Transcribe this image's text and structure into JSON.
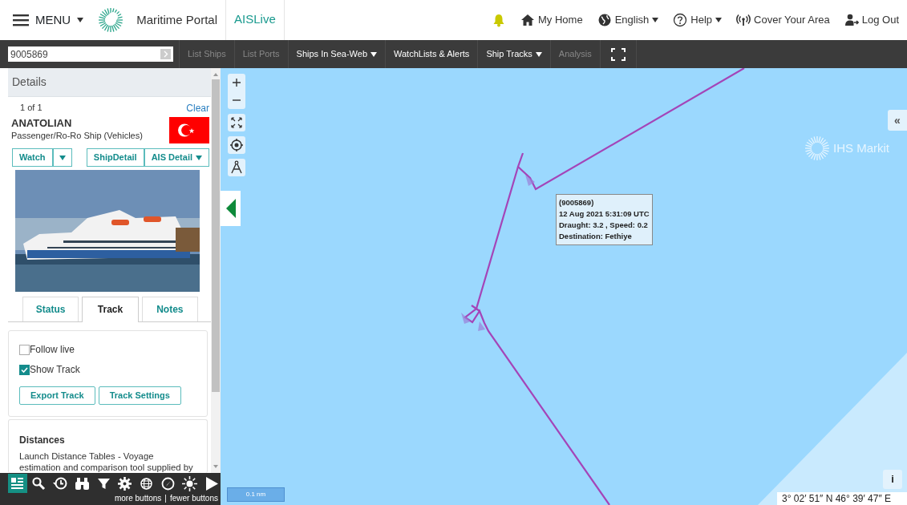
{
  "header": {
    "menu_label": "MENU",
    "portal_title": "Maritime Portal",
    "app_name": "AISLive",
    "links": [
      {
        "label": "My Home",
        "dropdown": false
      },
      {
        "label": "English",
        "dropdown": true
      },
      {
        "label": "Help",
        "dropdown": true
      },
      {
        "label": "Cover Your Area",
        "dropdown": false
      },
      {
        "label": "Log Out",
        "dropdown": false
      }
    ]
  },
  "toolbar": {
    "search_value": "9005869",
    "items": [
      {
        "label": "List Ships",
        "disabled": true,
        "dropdown": false
      },
      {
        "label": "List Ports",
        "disabled": true,
        "dropdown": false
      },
      {
        "label": "Ships In Sea-Web",
        "disabled": false,
        "dropdown": true
      },
      {
        "label": "WatchLists & Alerts",
        "disabled": false,
        "dropdown": false
      },
      {
        "label": "Ship Tracks",
        "disabled": false,
        "dropdown": true
      },
      {
        "label": "Analysis",
        "disabled": true,
        "dropdown": false
      }
    ]
  },
  "details": {
    "title": "Details",
    "count": "1 of 1",
    "clear": "Clear",
    "ship_name": "ANATOLIAN",
    "ship_type": "Passenger/Ro-Ro Ship (Vehicles)",
    "buttons": [
      {
        "label": "Watch",
        "dropdown": false
      },
      {
        "dropdown": true
      },
      {
        "label": "ShipDetail",
        "dropdown": false
      },
      {
        "label": "AIS Detail",
        "dropdown": true
      }
    ],
    "tabs": [
      {
        "label": "Status",
        "selected": false
      },
      {
        "label": "Track",
        "selected": true
      },
      {
        "label": "Notes",
        "selected": false
      }
    ],
    "options": [
      {
        "label": "Follow live",
        "checked": false
      },
      {
        "label": "Show Track",
        "checked": true
      }
    ],
    "actions": [
      "Export Track",
      "Track Settings"
    ],
    "distances_title": "Distances",
    "distances_text": "Launch Distance Tables - Voyage estimation and comparison tool supplied by"
  },
  "bottom_tools": {
    "items": [
      {
        "selected": true
      },
      {
        "selected": false
      },
      {
        "selected": false
      },
      {
        "selected": false
      },
      {
        "selected": false
      },
      {
        "selected": false
      },
      {
        "selected": false
      },
      {
        "selected": false
      },
      {
        "selected": false
      },
      {
        "selected": false
      }
    ],
    "more": "more buttons",
    "separator": "|",
    "fewer": "fewer buttons"
  },
  "map": {
    "tooltip": [
      "(9005869)",
      "12 Aug 2021 5:31:09 UTC",
      "Draught: 3.2 , Speed: 0.2",
      "Destination: Fethiye"
    ],
    "expand_label": "«",
    "info_label": "i",
    "attribution": "IHS Markit",
    "scale": "0.1 nm",
    "coordinates": "3° 02′ 51″ N 46° 39′ 47″ E"
  }
}
